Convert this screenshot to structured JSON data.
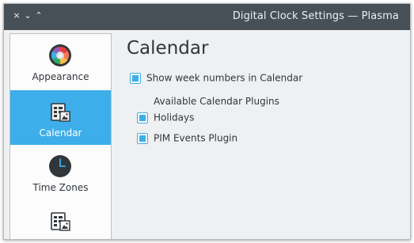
{
  "window": {
    "title": "Digital Clock Settings — Plasma",
    "controls": {
      "close": "×",
      "minimize": "⌄",
      "maximize": "⌃"
    }
  },
  "sidebar": {
    "items": [
      {
        "label": "Appearance",
        "icon": "color-wheel-icon",
        "active": false
      },
      {
        "label": "Calendar",
        "icon": "calendar-icon",
        "active": true
      },
      {
        "label": "Time Zones",
        "icon": "clock-icon",
        "active": false
      },
      {
        "label": "",
        "icon": "calendar-icon",
        "active": false
      }
    ]
  },
  "main": {
    "heading": "Calendar",
    "show_week_numbers": {
      "label": "Show week numbers in Calendar",
      "checked": true
    },
    "plugins_heading": "Available Calendar Plugins",
    "plugins": [
      {
        "label": "Holidays",
        "checked": true
      },
      {
        "label": "PIM Events Plugin",
        "checked": true
      }
    ]
  },
  "colors": {
    "accent": "#3daee9",
    "titlebar": "#475057",
    "window_bg": "#eff0f1"
  }
}
